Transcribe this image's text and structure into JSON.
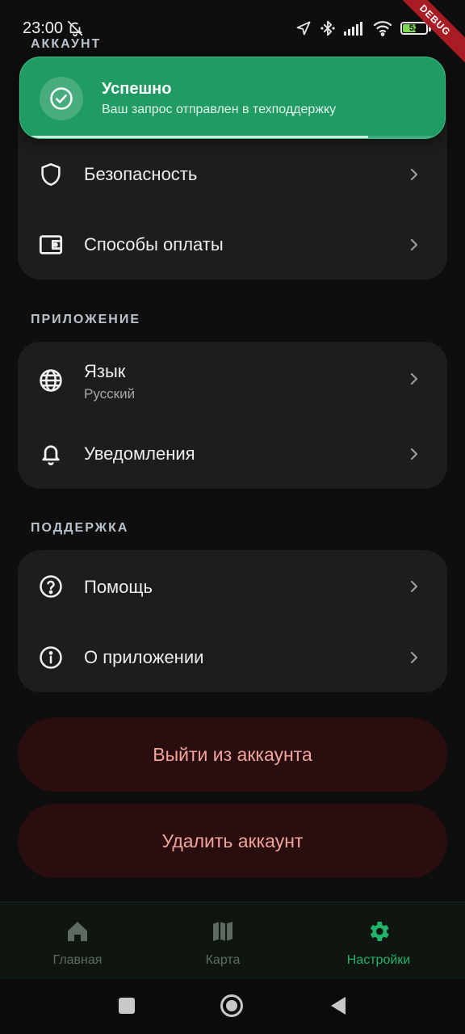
{
  "status_bar": {
    "time": "23:00",
    "battery_level": "52",
    "debug_label": "DEBUG",
    "icons": [
      "bell-off-icon",
      "navigation-icon",
      "bluetooth-icon",
      "signal-icon",
      "wifi-icon",
      "battery-icon"
    ]
  },
  "toast": {
    "title": "Успешно",
    "message": "Ваш запрос отправлен в техподдержку",
    "progress": 0.82,
    "color": "#1f9b63"
  },
  "sections": {
    "account": {
      "label": "АККАУНТ",
      "items": [
        {
          "title": "Безопасность",
          "icon": "shield-icon"
        },
        {
          "title": "Способы оплаты",
          "icon": "wallet-icon"
        }
      ]
    },
    "app": {
      "label": "ПРИЛОЖЕНИЕ",
      "items": [
        {
          "title": "Язык",
          "subtitle": "Русский",
          "icon": "globe-icon"
        },
        {
          "title": "Уведомления",
          "icon": "bell-icon"
        }
      ]
    },
    "support": {
      "label": "ПОДДЕРЖКА",
      "items": [
        {
          "title": "Помощь",
          "icon": "help-circle-icon"
        },
        {
          "title": "О приложении",
          "icon": "info-icon"
        }
      ]
    }
  },
  "buttons": {
    "logout": "Выйти из аккаунта",
    "delete": "Удалить аккаунт"
  },
  "bottom_nav": {
    "items": [
      {
        "label": "Главная",
        "icon": "home-icon",
        "active": false
      },
      {
        "label": "Карта",
        "icon": "map-icon",
        "active": false
      },
      {
        "label": "Настройки",
        "icon": "gear-icon",
        "active": true
      }
    ]
  },
  "colors": {
    "background": "#0e0e0e",
    "card": "#1d1d1d",
    "accent": "#22b36a",
    "danger_bg": "#2a0d0e",
    "danger_text": "#f1a49c"
  }
}
